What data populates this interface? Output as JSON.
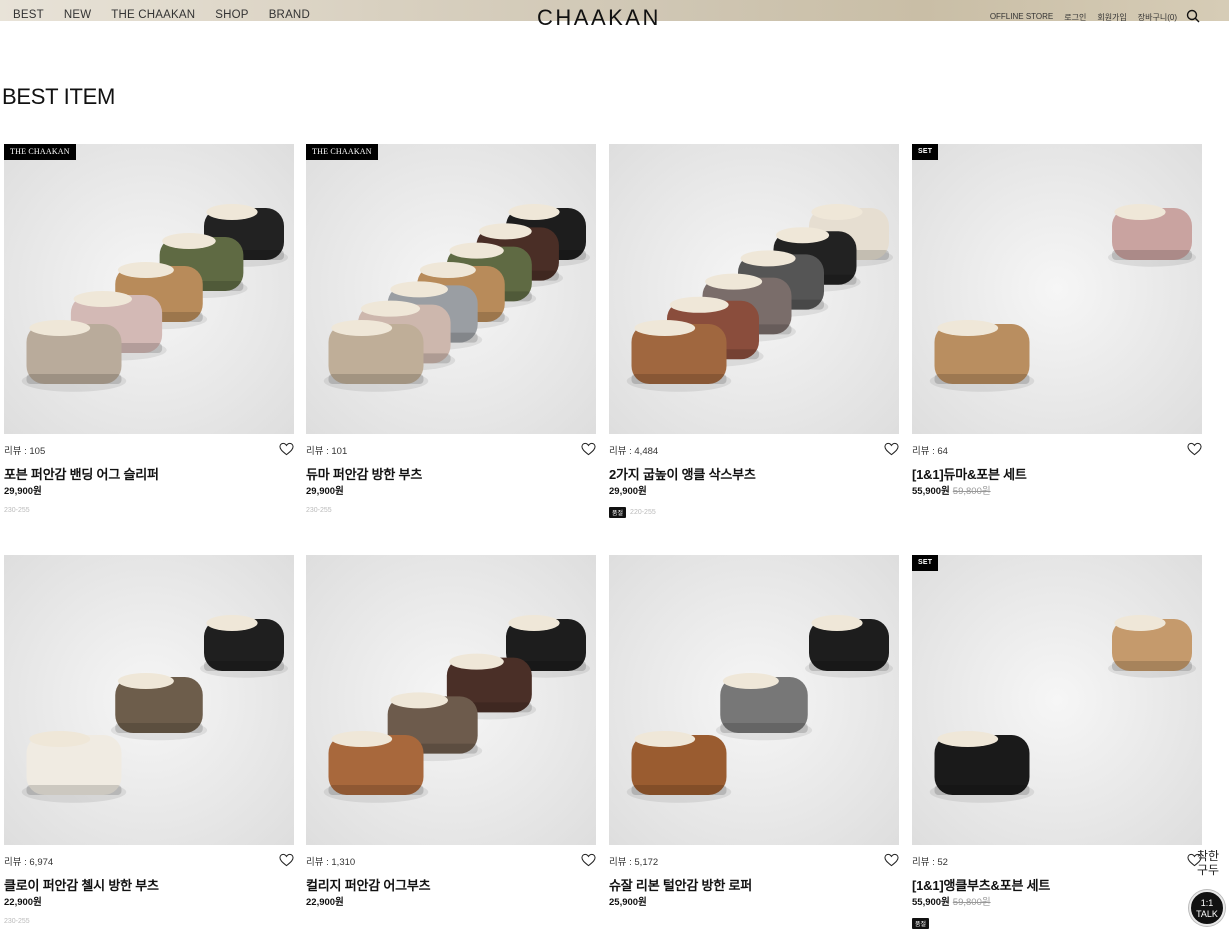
{
  "header": {
    "nav": [
      "BEST",
      "NEW",
      "THE CHAAKAN",
      "SHOP",
      "BRAND"
    ],
    "logo": "CHAAKAN",
    "util": [
      "OFFLINE STORE",
      "로그인",
      "회원가입",
      "장바구니(0)"
    ]
  },
  "section_title": "BEST ITEM",
  "products": [
    {
      "badge": "THE CHAAKAN",
      "badge_type": "brand",
      "reviews": "리뷰 : 105",
      "name": "포븐 퍼안감 밴딩 어그 슬리퍼",
      "price": "29,900원",
      "orig": "",
      "size": "230-255",
      "size_tag": ""
    },
    {
      "badge": "THE CHAAKAN",
      "badge_type": "brand",
      "reviews": "리뷰 : 101",
      "name": "듀마 퍼안감 방한 부츠",
      "price": "29,900원",
      "orig": "",
      "size": "230-255",
      "size_tag": ""
    },
    {
      "badge": "",
      "badge_type": "",
      "reviews": "리뷰 : 4,484",
      "name": "2가지 굽높이 앵클 삭스부츠",
      "price": "29,900원",
      "orig": "",
      "size": "220-255",
      "size_tag": "품절"
    },
    {
      "badge": "SET",
      "badge_type": "set",
      "reviews": "리뷰 : 64",
      "name": "[1&1]듀마&포븐 세트",
      "price": "55,900원",
      "orig": "59,800원",
      "size": "",
      "size_tag": ""
    },
    {
      "badge": "",
      "badge_type": "",
      "reviews": "리뷰 : 6,974",
      "name": "클로이 퍼안감 첼시 방한 부츠",
      "price": "22,900원",
      "orig": "",
      "size": "230-255",
      "size_tag": ""
    },
    {
      "badge": "",
      "badge_type": "",
      "reviews": "리뷰 : 1,310",
      "name": "컬리지 퍼안감 어그부츠",
      "price": "22,900원",
      "orig": "",
      "size": "",
      "size_tag": ""
    },
    {
      "badge": "",
      "badge_type": "",
      "reviews": "리뷰 : 5,172",
      "name": "슈잘 리본 털안감 방한 로퍼",
      "price": "25,900원",
      "orig": "",
      "size": "",
      "size_tag": ""
    },
    {
      "badge": "SET",
      "badge_type": "set",
      "reviews": "리뷰 : 52",
      "name": "[1&1]앵클부츠&포븐 세트",
      "price": "55,900원",
      "orig": "59,800원",
      "size": "",
      "size_tag": "품절"
    }
  ],
  "floating": {
    "brand_line1": "착한",
    "brand_line2": "구두",
    "talk_line1": "1:1",
    "talk_line2": "TALK"
  },
  "colors": {
    "accent": "#000000",
    "header_bg": "#d6ccb6"
  }
}
